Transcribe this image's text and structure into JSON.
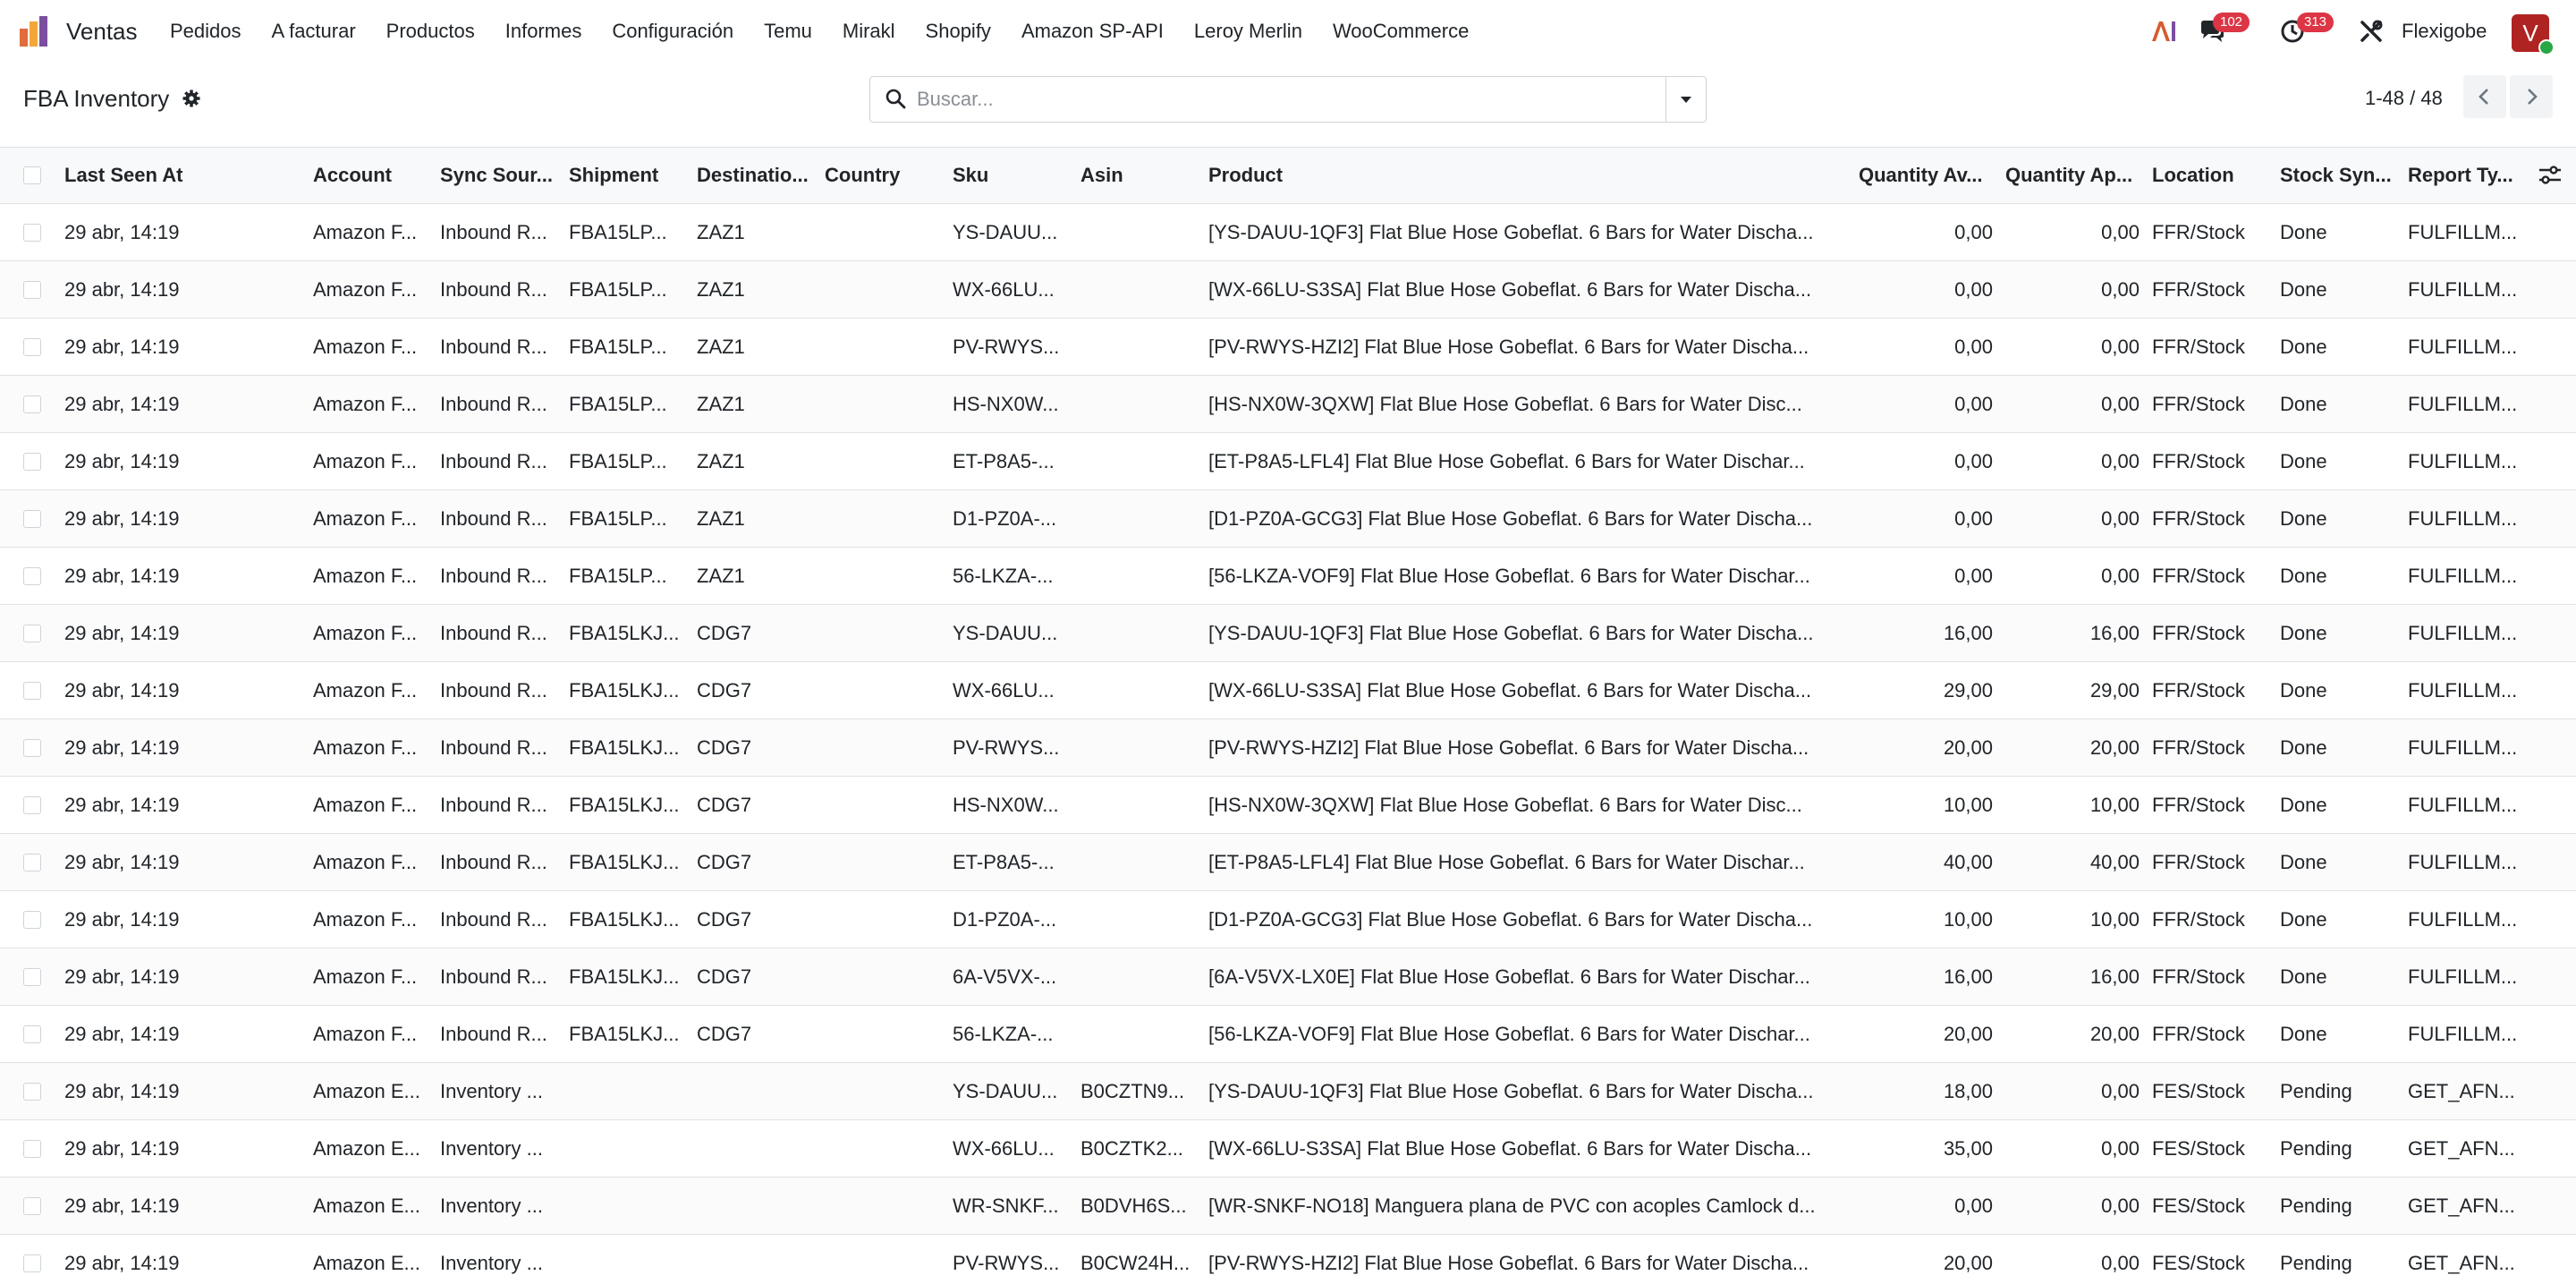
{
  "navbar": {
    "app_name": "Ventas",
    "menu": [
      "Pedidos",
      "A facturar",
      "Productos",
      "Informes",
      "Configuración",
      "Temu",
      "Mirakl",
      "Shopify",
      "Amazon SP-API",
      "Leroy Merlin",
      "WooCommerce"
    ],
    "messages_count": "102",
    "activities_count": "313",
    "company": "Flexigobe",
    "avatar_letter": "V"
  },
  "control": {
    "title": "FBA Inventory",
    "search_placeholder": "Buscar...",
    "pager": "1-48 / 48"
  },
  "table": {
    "columns": [
      "Last Seen At",
      "Account",
      "Sync Sour...",
      "Shipment",
      "Destinatio...",
      "Country",
      "Sku",
      "Asin",
      "Product",
      "Quantity Av...",
      "Quantity Ap...",
      "Location",
      "Stock Syn...",
      "Report Ty..."
    ],
    "rows": [
      [
        "29 abr, 14:19",
        "Amazon F...",
        "Inbound R...",
        "FBA15LP...",
        "ZAZ1",
        "",
        "YS-DAUU...",
        "",
        "[YS-DAUU-1QF3] Flat Blue Hose Gobeflat. 6 Bars for Water Discha...",
        "0,00",
        "0,00",
        "FFR/Stock",
        "Done",
        "FULFILLM..."
      ],
      [
        "29 abr, 14:19",
        "Amazon F...",
        "Inbound R...",
        "FBA15LP...",
        "ZAZ1",
        "",
        "WX-66LU...",
        "",
        "[WX-66LU-S3SA] Flat Blue Hose Gobeflat. 6 Bars for Water Discha...",
        "0,00",
        "0,00",
        "FFR/Stock",
        "Done",
        "FULFILLM..."
      ],
      [
        "29 abr, 14:19",
        "Amazon F...",
        "Inbound R...",
        "FBA15LP...",
        "ZAZ1",
        "",
        "PV-RWYS...",
        "",
        "[PV-RWYS-HZI2] Flat Blue Hose Gobeflat. 6 Bars for Water Discha...",
        "0,00",
        "0,00",
        "FFR/Stock",
        "Done",
        "FULFILLM..."
      ],
      [
        "29 abr, 14:19",
        "Amazon F...",
        "Inbound R...",
        "FBA15LP...",
        "ZAZ1",
        "",
        "HS-NX0W...",
        "",
        "[HS-NX0W-3QXW] Flat Blue Hose Gobeflat. 6 Bars for Water Disc...",
        "0,00",
        "0,00",
        "FFR/Stock",
        "Done",
        "FULFILLM..."
      ],
      [
        "29 abr, 14:19",
        "Amazon F...",
        "Inbound R...",
        "FBA15LP...",
        "ZAZ1",
        "",
        "ET-P8A5-...",
        "",
        "[ET-P8A5-LFL4] Flat Blue Hose Gobeflat. 6 Bars for Water Dischar...",
        "0,00",
        "0,00",
        "FFR/Stock",
        "Done",
        "FULFILLM..."
      ],
      [
        "29 abr, 14:19",
        "Amazon F...",
        "Inbound R...",
        "FBA15LP...",
        "ZAZ1",
        "",
        "D1-PZ0A-...",
        "",
        "[D1-PZ0A-GCG3] Flat Blue Hose Gobeflat. 6 Bars for Water Discha...",
        "0,00",
        "0,00",
        "FFR/Stock",
        "Done",
        "FULFILLM..."
      ],
      [
        "29 abr, 14:19",
        "Amazon F...",
        "Inbound R...",
        "FBA15LP...",
        "ZAZ1",
        "",
        "56-LKZA-...",
        "",
        "[56-LKZA-VOF9] Flat Blue Hose Gobeflat. 6 Bars for Water Dischar...",
        "0,00",
        "0,00",
        "FFR/Stock",
        "Done",
        "FULFILLM..."
      ],
      [
        "29 abr, 14:19",
        "Amazon F...",
        "Inbound R...",
        "FBA15LKJ...",
        "CDG7",
        "",
        "YS-DAUU...",
        "",
        "[YS-DAUU-1QF3] Flat Blue Hose Gobeflat. 6 Bars for Water Discha...",
        "16,00",
        "16,00",
        "FFR/Stock",
        "Done",
        "FULFILLM..."
      ],
      [
        "29 abr, 14:19",
        "Amazon F...",
        "Inbound R...",
        "FBA15LKJ...",
        "CDG7",
        "",
        "WX-66LU...",
        "",
        "[WX-66LU-S3SA] Flat Blue Hose Gobeflat. 6 Bars for Water Discha...",
        "29,00",
        "29,00",
        "FFR/Stock",
        "Done",
        "FULFILLM..."
      ],
      [
        "29 abr, 14:19",
        "Amazon F...",
        "Inbound R...",
        "FBA15LKJ...",
        "CDG7",
        "",
        "PV-RWYS...",
        "",
        "[PV-RWYS-HZI2] Flat Blue Hose Gobeflat. 6 Bars for Water Discha...",
        "20,00",
        "20,00",
        "FFR/Stock",
        "Done",
        "FULFILLM..."
      ],
      [
        "29 abr, 14:19",
        "Amazon F...",
        "Inbound R...",
        "FBA15LKJ...",
        "CDG7",
        "",
        "HS-NX0W...",
        "",
        "[HS-NX0W-3QXW] Flat Blue Hose Gobeflat. 6 Bars for Water Disc...",
        "10,00",
        "10,00",
        "FFR/Stock",
        "Done",
        "FULFILLM..."
      ],
      [
        "29 abr, 14:19",
        "Amazon F...",
        "Inbound R...",
        "FBA15LKJ...",
        "CDG7",
        "",
        "ET-P8A5-...",
        "",
        "[ET-P8A5-LFL4] Flat Blue Hose Gobeflat. 6 Bars for Water Dischar...",
        "40,00",
        "40,00",
        "FFR/Stock",
        "Done",
        "FULFILLM..."
      ],
      [
        "29 abr, 14:19",
        "Amazon F...",
        "Inbound R...",
        "FBA15LKJ...",
        "CDG7",
        "",
        "D1-PZ0A-...",
        "",
        "[D1-PZ0A-GCG3] Flat Blue Hose Gobeflat. 6 Bars for Water Discha...",
        "10,00",
        "10,00",
        "FFR/Stock",
        "Done",
        "FULFILLM..."
      ],
      [
        "29 abr, 14:19",
        "Amazon F...",
        "Inbound R...",
        "FBA15LKJ...",
        "CDG7",
        "",
        "6A-V5VX-...",
        "",
        "[6A-V5VX-LX0E] Flat Blue Hose Gobeflat. 6 Bars for Water Dischar...",
        "16,00",
        "16,00",
        "FFR/Stock",
        "Done",
        "FULFILLM..."
      ],
      [
        "29 abr, 14:19",
        "Amazon F...",
        "Inbound R...",
        "FBA15LKJ...",
        "CDG7",
        "",
        "56-LKZA-...",
        "",
        "[56-LKZA-VOF9] Flat Blue Hose Gobeflat. 6 Bars for Water Dischar...",
        "20,00",
        "20,00",
        "FFR/Stock",
        "Done",
        "FULFILLM..."
      ],
      [
        "29 abr, 14:19",
        "Amazon E...",
        "Inventory ...",
        "",
        "",
        "",
        "YS-DAUU...",
        "B0CZTN9...",
        "[YS-DAUU-1QF3] Flat Blue Hose Gobeflat. 6 Bars for Water Discha...",
        "18,00",
        "0,00",
        "FES/Stock",
        "Pending",
        "GET_AFN..."
      ],
      [
        "29 abr, 14:19",
        "Amazon E...",
        "Inventory ...",
        "",
        "",
        "",
        "WX-66LU...",
        "B0CZTK2...",
        "[WX-66LU-S3SA] Flat Blue Hose Gobeflat. 6 Bars for Water Discha...",
        "35,00",
        "0,00",
        "FES/Stock",
        "Pending",
        "GET_AFN..."
      ],
      [
        "29 abr, 14:19",
        "Amazon E...",
        "Inventory ...",
        "",
        "",
        "",
        "WR-SNKF...",
        "B0DVH6S...",
        "[WR-SNKF-NO18] Manguera plana de PVC con acoples Camlock d...",
        "0,00",
        "0,00",
        "FES/Stock",
        "Pending",
        "GET_AFN..."
      ],
      [
        "29 abr, 14:19",
        "Amazon E...",
        "Inventory ...",
        "",
        "",
        "",
        "PV-RWYS...",
        "B0CW24H...",
        "[PV-RWYS-HZI2] Flat Blue Hose Gobeflat. 6 Bars for Water Discha...",
        "20,00",
        "0,00",
        "FES/Stock",
        "Pending",
        "GET_AFN..."
      ]
    ]
  },
  "colors": {
    "badge": "#dc3545",
    "avatar": "#b02323",
    "header_bg": "#f8f9fa"
  }
}
